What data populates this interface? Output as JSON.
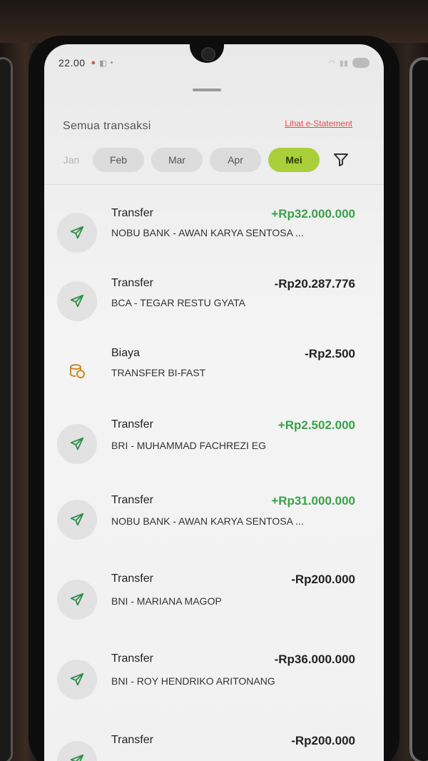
{
  "status_bar": {
    "time": "22.00",
    "battery": "60"
  },
  "sheet": {
    "title": "Semua transaksi",
    "estatement_link": "Lihat e-Statement"
  },
  "months": [
    {
      "label": "Jan",
      "state": "faded"
    },
    {
      "label": "Feb",
      "state": "normal"
    },
    {
      "label": "Mar",
      "state": "normal"
    },
    {
      "label": "Apr",
      "state": "normal"
    },
    {
      "label": "Mei",
      "state": "active"
    }
  ],
  "colors": {
    "accent_green": "#a9cf3b",
    "credit_green": "#3aa14a",
    "link_red": "#d9534f"
  },
  "transactions": [
    {
      "type": "Transfer",
      "description": "NOBU BANK - AWAN KARYA SENTOSA ...",
      "amount": "+Rp32.000.000",
      "direction": "credit",
      "icon": "send-icon"
    },
    {
      "type": "Transfer",
      "description": "BCA - TEGAR RESTU GYATA",
      "amount": "-Rp20.287.776",
      "direction": "debit",
      "icon": "send-icon"
    },
    {
      "type": "Biaya",
      "description": "TRANSFER BI-FAST",
      "amount": "-Rp2.500",
      "direction": "debit",
      "icon": "coins-icon"
    },
    {
      "type": "Transfer",
      "description": "BRI - MUHAMMAD FACHREZI EG",
      "amount": "+Rp2.502.000",
      "direction": "credit",
      "icon": "send-icon"
    },
    {
      "type": "Transfer",
      "description": "NOBU BANK - AWAN KARYA SENTOSA ...",
      "amount": "+Rp31.000.000",
      "direction": "credit",
      "icon": "send-icon"
    },
    {
      "type": "Transfer",
      "description": "BNI - MARIANA MAGOP",
      "amount": "-Rp200.000",
      "direction": "debit",
      "icon": "send-icon"
    },
    {
      "type": "Transfer",
      "description": "BNI - ROY HENDRIKO ARITONANG",
      "amount": "-Rp36.000.000",
      "direction": "debit",
      "icon": "send-icon"
    },
    {
      "type": "Transfer",
      "description": "",
      "amount": "-Rp200.000",
      "direction": "debit",
      "icon": "send-icon"
    }
  ]
}
